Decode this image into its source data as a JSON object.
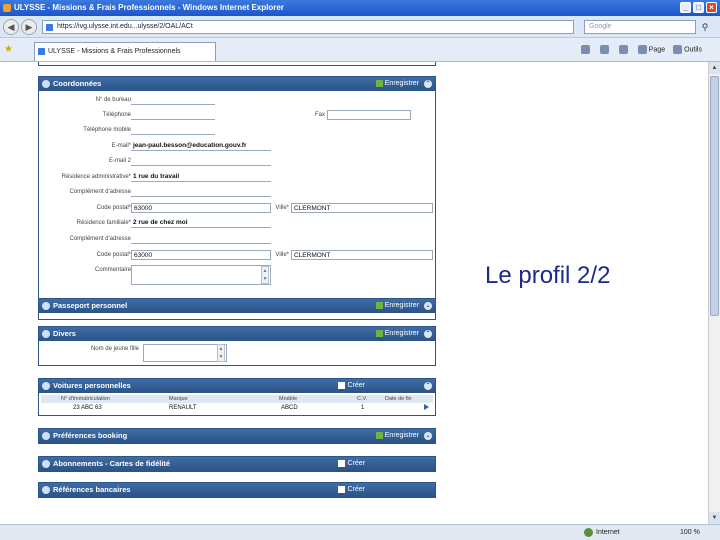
{
  "window": {
    "title": "ULYSSE - Missions & Frais Professionnels - Windows Internet Explorer"
  },
  "address": {
    "url": "https://ivg.ulysse.int.edu...ulysse/2/OAL/ACt",
    "search_placeholder": "Google"
  },
  "tab": {
    "label": "ULYSSE - Missions & Frais Professionnels"
  },
  "tools": {
    "home": "Page",
    "tools": "Outils"
  },
  "coordonnees": {
    "title": "Coordonnées",
    "action": "Enregistrer",
    "labels": {
      "bureau": "N° de bureau",
      "telephone": "Téléphone",
      "fax": "Fax",
      "mobile": "Téléphone mobile",
      "email": "E-mail*",
      "email2": "E-mail 2",
      "adresse_admin": "Résidence administrative*",
      "complement1": "Complément d'adresse",
      "cp1": "Code postal*",
      "ville1": "Ville*",
      "residence": "Résidence familiale*",
      "complement2": "Complément d'adresse",
      "cp2": "Code postal*",
      "ville2": "Ville*",
      "commentaire": "Commentaire"
    },
    "values": {
      "email": "jean-paul.besson@education.gouv.fr",
      "adresse_admin": "1 rue du travail",
      "cp1": "63000",
      "ville1": "CLERMONT",
      "residence": "2 rue de chez moi",
      "cp2": "63000",
      "ville2": "CLERMONT"
    }
  },
  "passeport": {
    "title": "Passeport personnel",
    "action": "Enregistrer"
  },
  "divers": {
    "title": "Divers",
    "action": "Enregistrer",
    "label": "Nom de jeune fille"
  },
  "voitures": {
    "title": "Voitures personnelles",
    "action": "Créer",
    "columns": [
      "N° d'immatriculation",
      "Marque",
      "Modèle",
      "C.V.",
      "Date de fin"
    ],
    "rows": [
      {
        "immat": "23 ABC 63",
        "marque": "RENAULT",
        "modele": "ABCD",
        "cv": "1",
        "date": ""
      }
    ]
  },
  "preferences": {
    "title": "Préférences booking",
    "action": "Enregistrer"
  },
  "abonnements": {
    "title": "Abonnements - Cartes de fidélité",
    "action": "Créer"
  },
  "references": {
    "title": "Références bancaires",
    "action": "Créer"
  },
  "status": {
    "zone": "Internet",
    "zoom": "100 %"
  },
  "slide": {
    "caption": "Le profil 2/2"
  }
}
